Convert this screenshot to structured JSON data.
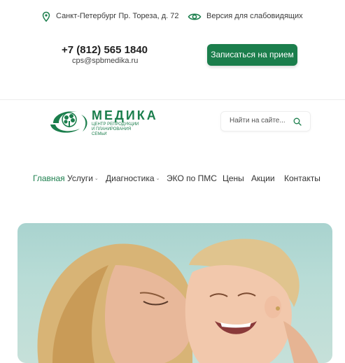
{
  "topbar": {
    "address": "Санкт-Петербург Пр. Тореза, д. 72",
    "accessibility": "Версия для слабовидящих",
    "address_icon": "map-pin-icon",
    "accessibility_icon": "eye-icon"
  },
  "contacts": {
    "phone": "+7 (812) 565 1840",
    "email": "cps@spbmedika.ru"
  },
  "cta": {
    "label": "Записаться на прием"
  },
  "logo": {
    "title": "МЕДИКА",
    "subtitle": "ЦЕНТР РЕПРОДУКЦИИ И ПЛАНИРОВАНИЯ СЕМЬИ"
  },
  "search": {
    "placeholder": "Найти на сайте...",
    "icon": "search-icon"
  },
  "nav": {
    "items": [
      {
        "label": "Главная",
        "active": true,
        "dropdown": false
      },
      {
        "label": "Услуги",
        "active": false,
        "dropdown": true
      },
      {
        "label": "Диагностика",
        "active": false,
        "dropdown": true
      },
      {
        "label": "ЭКО по ПМС",
        "active": false,
        "dropdown": false
      },
      {
        "label": "Цены",
        "active": false,
        "dropdown": false
      },
      {
        "label": "Акции",
        "active": false,
        "dropdown": false
      },
      {
        "label": "Контакты",
        "active": false,
        "dropdown": false
      }
    ]
  },
  "colors": {
    "brand": "#1b7e4c",
    "text": "#333333",
    "hero_bg": "#b8dcd6"
  }
}
